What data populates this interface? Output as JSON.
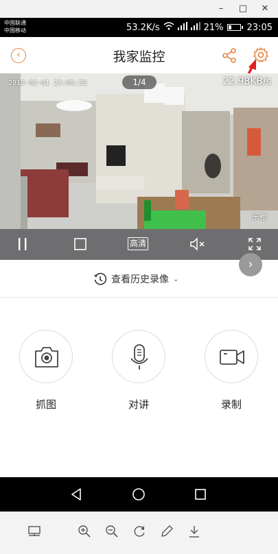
{
  "window": {
    "minimize": "–",
    "maximize": "□",
    "close": "✕"
  },
  "status_bar": {
    "carrier1": "中国联通",
    "carrier2": "中国移动",
    "net_speed": "53.2K/s",
    "battery_pct": "21%",
    "time": "23:05"
  },
  "header": {
    "title": "我家监控"
  },
  "video": {
    "timestamp": "2019-02-01 23:05:33",
    "page_indicator": "1/4",
    "bitrate": "22.98KB/s",
    "watermark": "乐橙"
  },
  "controls": {
    "quality_label": "高清"
  },
  "history": {
    "label": "查看历史录像"
  },
  "actions": [
    {
      "label": "抓图",
      "icon": "camera-icon"
    },
    {
      "label": "对讲",
      "icon": "microphone-icon"
    },
    {
      "label": "录制",
      "icon": "video-record-icon"
    }
  ],
  "colors": {
    "accent": "#e8823a",
    "annotation_arrow": "#e02020",
    "control_bar": "#6e6e70"
  }
}
